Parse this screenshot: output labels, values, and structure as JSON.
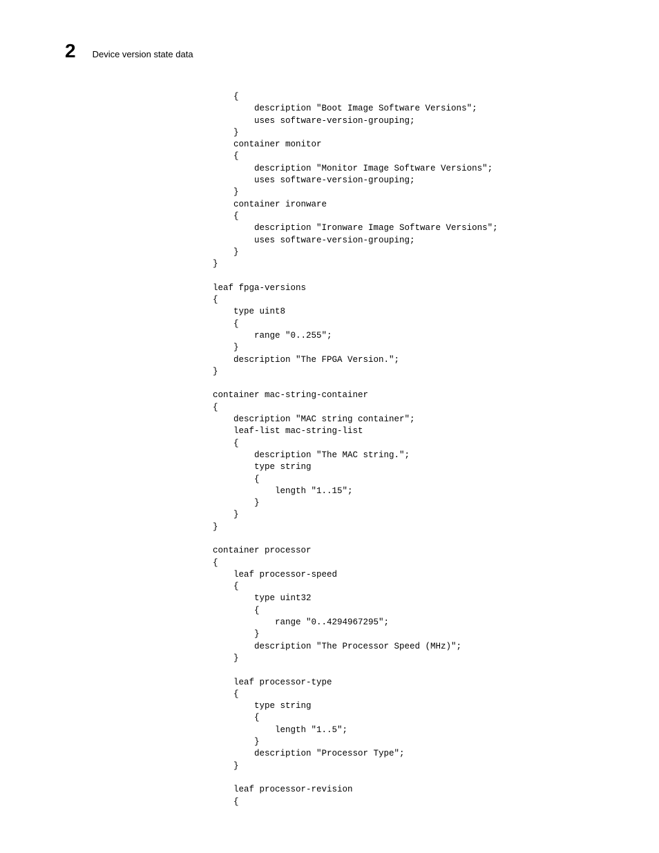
{
  "header": {
    "page_number": "2",
    "section_title": "Device version state data"
  },
  "code": {
    "lines": [
      "        {",
      "            description \"Boot Image Software Versions\";",
      "            uses software-version-grouping;",
      "        }",
      "        container monitor",
      "        {",
      "            description \"Monitor Image Software Versions\";",
      "            uses software-version-grouping;",
      "        }",
      "        container ironware",
      "        {",
      "            description \"Ironware Image Software Versions\";",
      "            uses software-version-grouping;",
      "        }",
      "    }",
      "",
      "    leaf fpga-versions",
      "    {",
      "        type uint8",
      "        {",
      "            range \"0..255\";",
      "        }",
      "        description \"The FPGA Version.\";",
      "    }",
      "",
      "    container mac-string-container",
      "    {",
      "        description \"MAC string container\";",
      "        leaf-list mac-string-list",
      "        {",
      "            description \"The MAC string.\";",
      "            type string",
      "            {",
      "                length \"1..15\";",
      "            }",
      "        }",
      "    }",
      "",
      "    container processor",
      "    {",
      "        leaf processor-speed",
      "        {",
      "            type uint32",
      "            {",
      "                range \"0..4294967295\";",
      "            }",
      "            description \"The Processor Speed (MHz)\";",
      "        }",
      "",
      "        leaf processor-type",
      "        {",
      "            type string",
      "            {",
      "                length \"1..5\";",
      "            }",
      "            description \"Processor Type\";",
      "        }",
      "",
      "        leaf processor-revision",
      "        {"
    ]
  }
}
